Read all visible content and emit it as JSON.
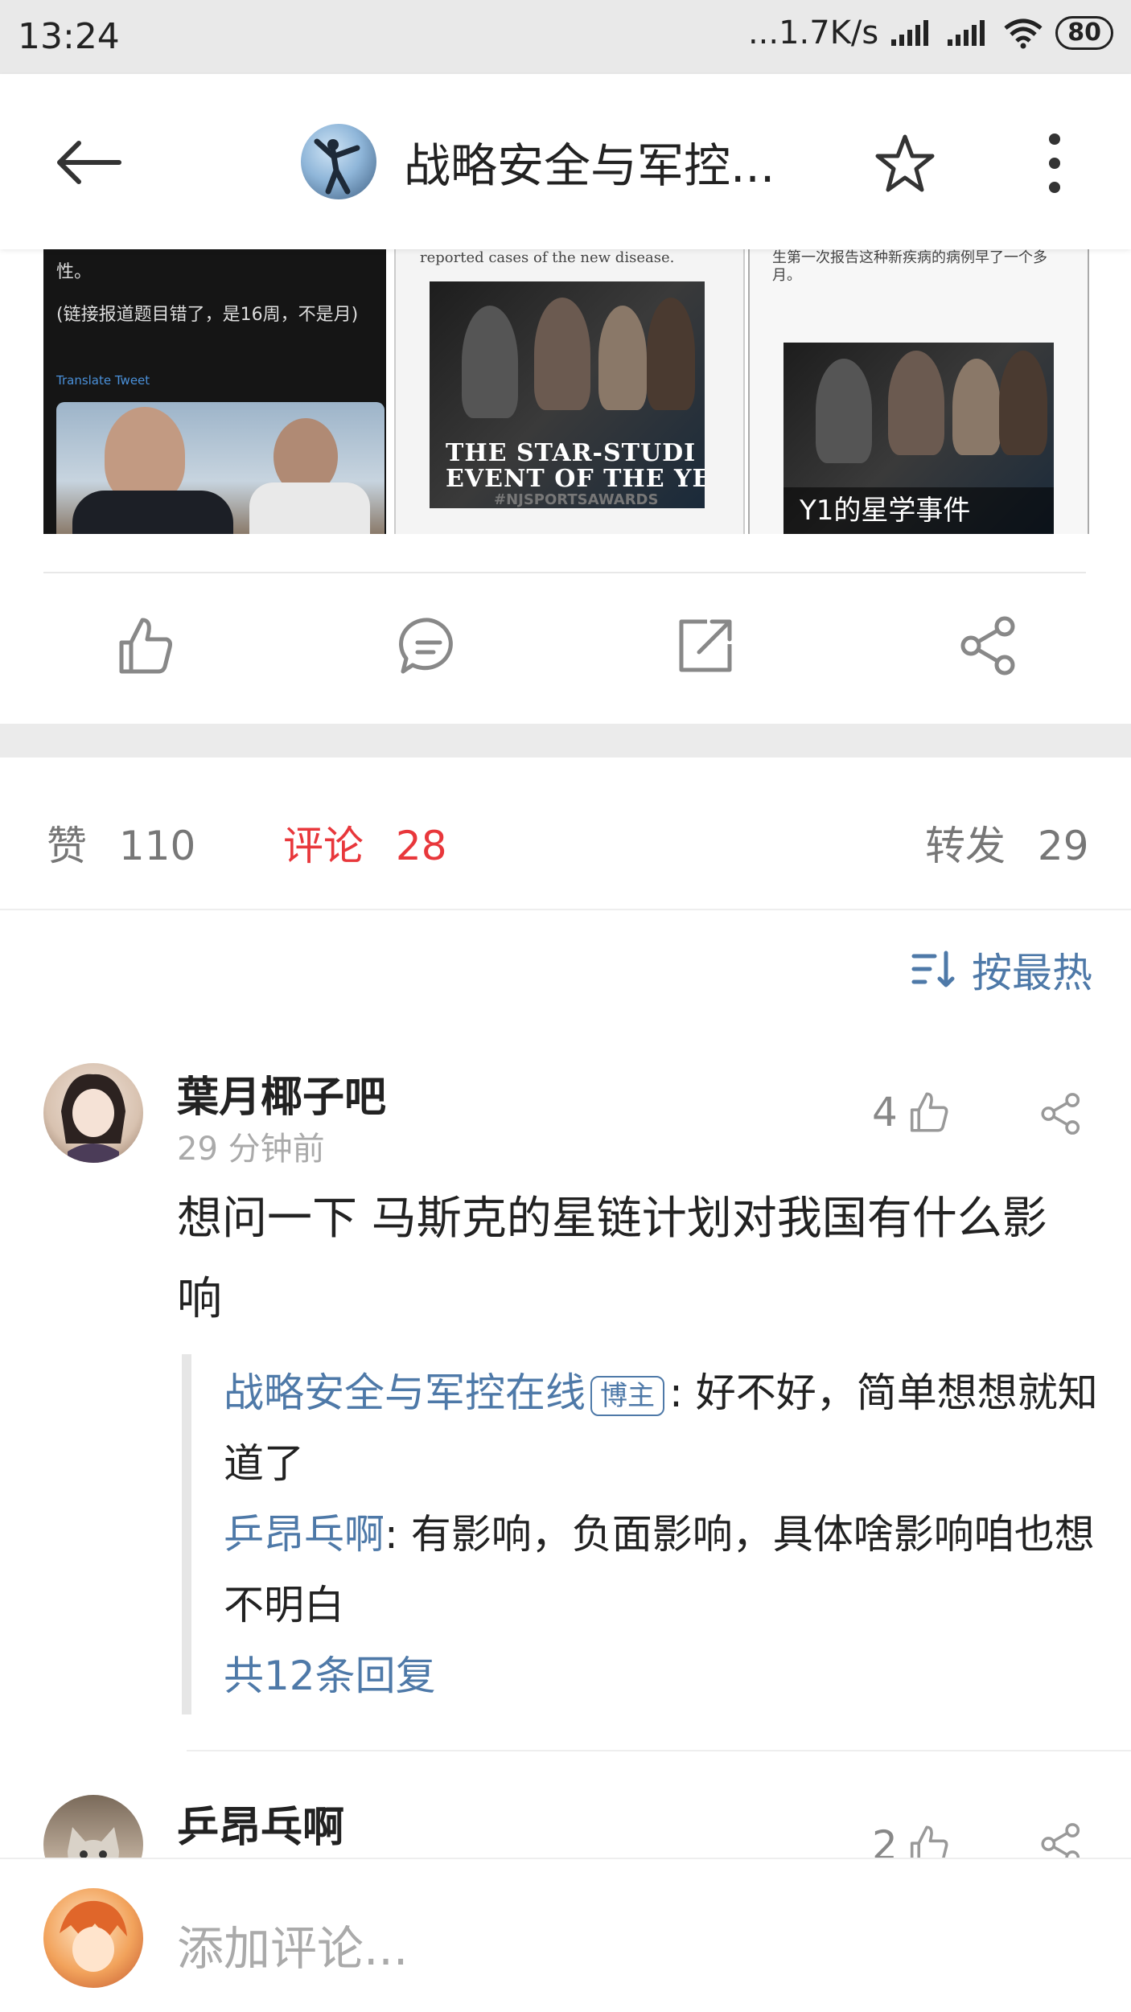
{
  "status_bar": {
    "time": "13:24",
    "network_speed": "...1.7K/s",
    "battery": "80"
  },
  "nav": {
    "title": "战略安全与军控...",
    "icons": [
      "back-arrow-icon",
      "star-icon",
      "more-vertical-icon"
    ]
  },
  "images": {
    "card1_text_1": "性。",
    "card1_text_2": "(链接报道题目错了，是16周，不是月)",
    "card1_translate": "Translate Tweet",
    "card2_caption": "reported cases of the new disease.",
    "card2_poster_line1": "THE STAR-STUDI",
    "card2_poster_line2": "EVENT OF THE YE",
    "card2_poster_tag": "#NJSPORTSAWARDS",
    "card3_caption": "生第一次报告这种新疾病的病例早了一个多月。",
    "card3_overlay": "Y1的星学事件"
  },
  "actions": [
    "like-icon",
    "comment-icon",
    "forward-icon",
    "share-icon"
  ],
  "stats": {
    "likes_label": "赞",
    "likes": "110",
    "comments_label": "评论",
    "comments": "28",
    "reposts_label": "转发",
    "reposts": "29",
    "active_color": "#e8373b"
  },
  "sort": {
    "label": "按最热",
    "icon": "sort-icon"
  },
  "comments": [
    {
      "name": "葉月椰子吧",
      "time": "29 分钟前",
      "likes": "4",
      "body": "想问一下 马斯克的星链计划对我国有什么影响",
      "replies": [
        {
          "author": "战略安全与军控在线",
          "badge": "博主",
          "text": ": 好不好，简单想想就知道了"
        },
        {
          "author": "乒昂乓啊",
          "text": ": 有影响，负面影响，具体啥影响咱也想不明白"
        }
      ],
      "more_replies": "共12条回复"
    },
    {
      "name": "乒昂乓啊",
      "likes": "2"
    }
  ],
  "bottom": {
    "placeholder": "添加评论..."
  },
  "colors": {
    "link": "#4e79a8",
    "accent_red": "#e8373b"
  }
}
